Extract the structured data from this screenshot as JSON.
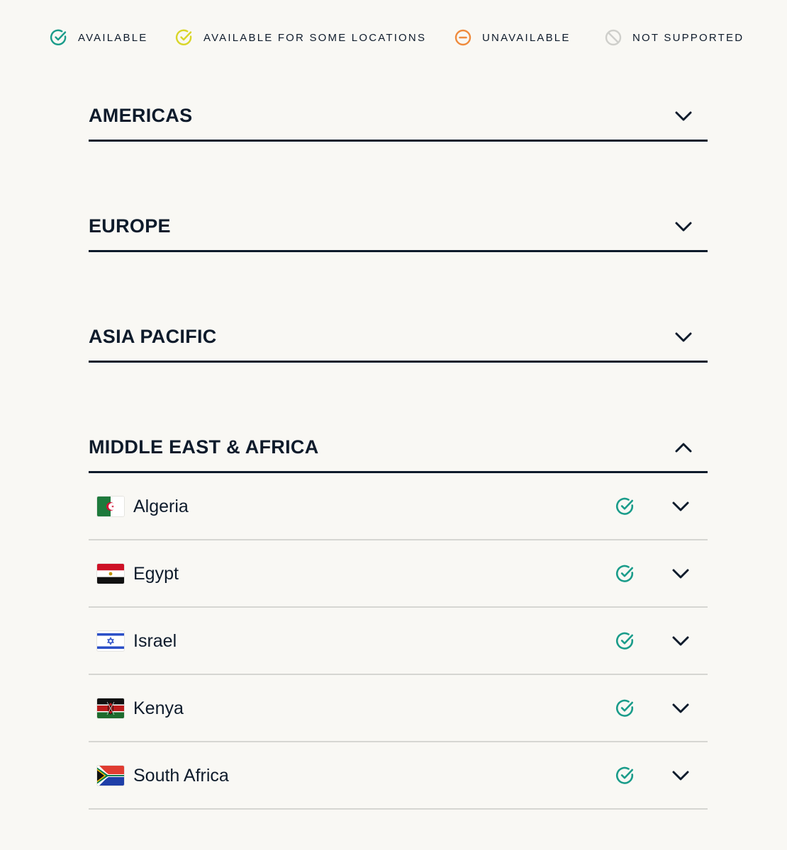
{
  "legend": [
    {
      "label": "AVAILABLE",
      "icon": "check-circle-icon",
      "color": "#1a9c8a"
    },
    {
      "label": "AVAILABLE FOR SOME LOCATIONS",
      "icon": "check-circle-icon",
      "color": "#d9d62a"
    },
    {
      "label": "UNAVAILABLE",
      "icon": "minus-circle-icon",
      "color": "#ef8a3c"
    },
    {
      "label": "NOT SUPPORTED",
      "icon": "prohibited-icon",
      "color": "#cfcfcb"
    }
  ],
  "regions": [
    {
      "title": "AMERICAS",
      "expanded": false
    },
    {
      "title": "EUROPE",
      "expanded": false
    },
    {
      "title": "ASIA PACIFIC",
      "expanded": false
    },
    {
      "title": "MIDDLE EAST & AFRICA",
      "expanded": true
    }
  ],
  "countries": [
    {
      "name": "Algeria",
      "flag": "algeria-flag-icon",
      "status": "available"
    },
    {
      "name": "Egypt",
      "flag": "egypt-flag-icon",
      "status": "available"
    },
    {
      "name": "Israel",
      "flag": "israel-flag-icon",
      "status": "available"
    },
    {
      "name": "Kenya",
      "flag": "kenya-flag-icon",
      "status": "available"
    },
    {
      "name": "South Africa",
      "flag": "south-africa-flag-icon",
      "status": "available"
    }
  ],
  "colors": {
    "text": "#0e1b2b",
    "background": "#f9f8f4",
    "available": "#1a9c8a",
    "partial": "#d9d62a",
    "unavailable": "#ef8a3c",
    "not_supported": "#cfcfcb"
  }
}
